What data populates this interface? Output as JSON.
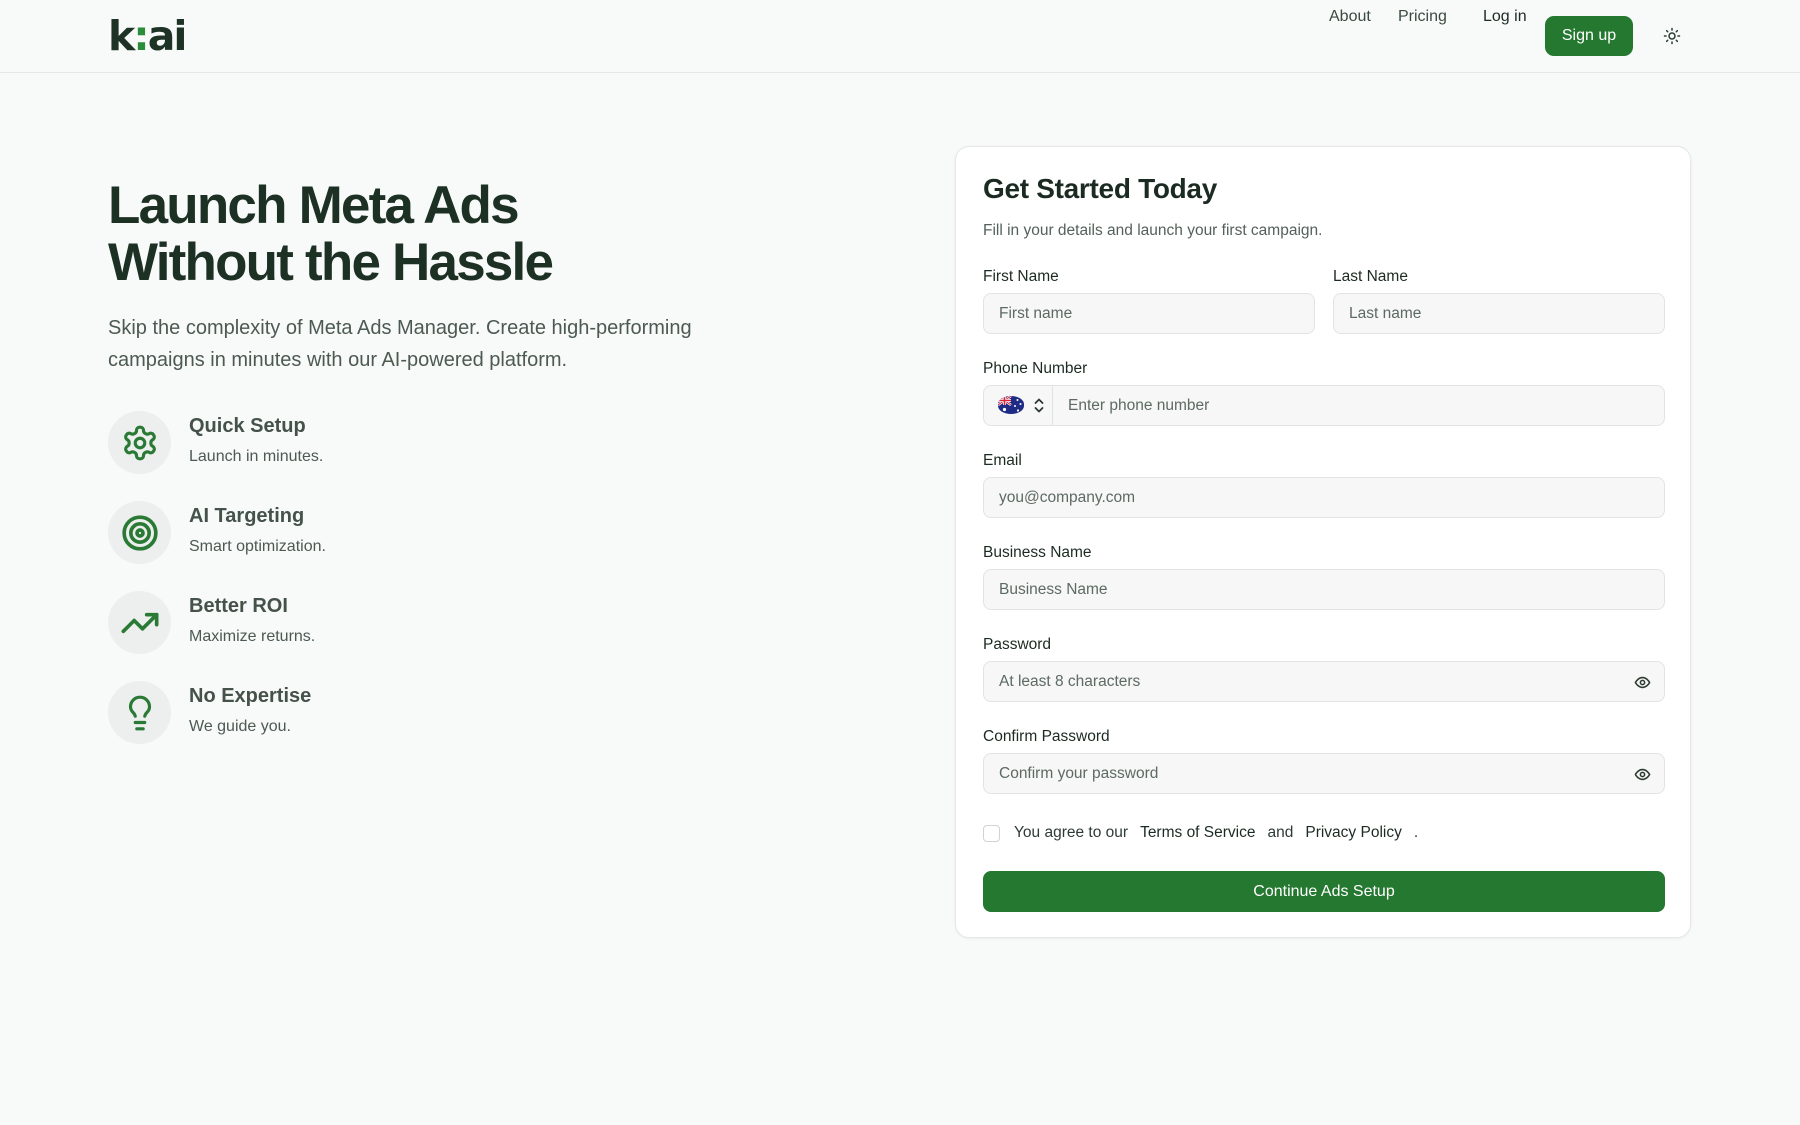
{
  "header": {
    "logo_text": "k:ai",
    "nav": {
      "about": "About",
      "pricing": "Pricing",
      "login": "Log in",
      "signup": "Sign up"
    },
    "theme_icon": "sun-icon"
  },
  "hero": {
    "title_line1": "Launch Meta Ads",
    "title_line2": "Without the Hassle",
    "subtitle": "Skip the complexity of Meta Ads Manager. Create high-performing campaigns in minutes with our AI-powered platform.",
    "features": [
      {
        "icon": "gear-icon",
        "title": "Quick Setup",
        "desc": "Launch in minutes."
      },
      {
        "icon": "target-icon",
        "title": "AI Targeting",
        "desc": "Smart optimization."
      },
      {
        "icon": "trending-up-icon",
        "title": "Better ROI",
        "desc": "Maximize returns."
      },
      {
        "icon": "lightbulb-icon",
        "title": "No Expertise",
        "desc": "We guide you."
      }
    ]
  },
  "form": {
    "title": "Get Started Today",
    "subtitle": "Fill in your details and launch your first campaign.",
    "first_name": {
      "label": "First Name",
      "placeholder": "First name",
      "value": ""
    },
    "last_name": {
      "label": "Last Name",
      "placeholder": "Last name",
      "value": ""
    },
    "phone": {
      "label": "Phone Number",
      "placeholder": "Enter phone number",
      "country_flag": "australia-flag-icon",
      "value": ""
    },
    "email": {
      "label": "Email",
      "placeholder": "you@company.com",
      "value": ""
    },
    "business": {
      "label": "Business Name",
      "placeholder": "Business Name",
      "value": ""
    },
    "password": {
      "label": "Password",
      "placeholder": "At least 8 characters",
      "value": ""
    },
    "confirm_password": {
      "label": "Confirm Password",
      "placeholder": "Confirm your password",
      "value": ""
    },
    "agree": {
      "prefix": "You agree to our",
      "terms": "Terms of Service",
      "and": "and",
      "privacy": "Privacy Policy",
      "suffix": ".",
      "checked": false
    },
    "submit_label": "Continue Ads Setup"
  },
  "colors": {
    "primary": "#24782f",
    "heading": "#1d3024",
    "icon_green": "#2a7a35",
    "background": "#f8f9f9"
  }
}
